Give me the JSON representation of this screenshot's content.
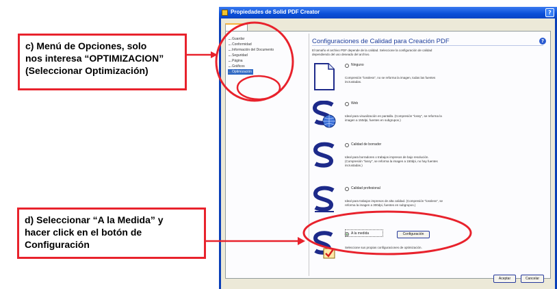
{
  "annotations": {
    "menu_note": {
      "lines": [
        "c) Menú de Opciones, solo",
        "nos interesa “OPTIMIZACION”",
        "(Seleccionar Optimización)"
      ]
    },
    "select_note": {
      "lines": [
        "d) Seleccionar “A la Medida” y",
        "hacer click en el botón de",
        "Configuración"
      ]
    },
    "highlight_color": "#e8222c"
  },
  "window": {
    "title": "Propiedades de Solid PDF Creator",
    "help_glyph": "?"
  },
  "tree": {
    "items": [
      {
        "label": "Guardar",
        "selected": false
      },
      {
        "label": "Conformidad",
        "selected": false
      },
      {
        "label": "Información del Documento",
        "selected": false
      },
      {
        "label": "Seguridad",
        "selected": false
      },
      {
        "label": "Página",
        "selected": false
      },
      {
        "label": "Gráficos",
        "selected": false
      },
      {
        "label": "Optimización",
        "selected": true
      }
    ]
  },
  "content": {
    "title": "Configuraciones de Calidad para Creación PDF",
    "description": [
      "El tamaño el archivo PDF depende de la calidad. Seleccione la configuración de calidad",
      "dependiendo del uso deseado del archivo."
    ],
    "options": [
      {
        "label": "Ninguno",
        "icon": "blank-page-icon",
        "selected": false,
        "desc": [
          "Compresión \"lossless\", no se reforma la imagen, todas las fuentes",
          "incrustadas."
        ]
      },
      {
        "label": "Web",
        "icon": "solid-web-globe-icon",
        "selected": false,
        "desc": [
          "Ideal para visualización en pantalla. (Compresión \"lossy\", se reforma la",
          "imagen a 150dpi, fuentes en subgrupos.)"
        ]
      },
      {
        "label": "Calidad de borrador",
        "icon": "solid-draft-icon",
        "selected": false,
        "desc": [
          "Ideal para borradores o trabajos impresos de bajo resolución.",
          "(Compresión \"lossy\", se reforma la imagen a 150dpi, no hay fuentes",
          "incrustadas.)"
        ]
      },
      {
        "label": "Calidad profesional",
        "icon": "solid-professional-icon",
        "selected": false,
        "desc": [
          "Ideal para trabajos impresos de alta calidad. (Compresión \"lossless\", se",
          "reforma la imagen a 300dpi, fuentes en subgrupos.)"
        ]
      },
      {
        "label": "A la medida",
        "icon": "solid-custom-check-icon",
        "selected": true,
        "desc": [
          "Seleccione sus propias configuraciones de optimización."
        ]
      }
    ],
    "config_button": "Configuración"
  },
  "buttons": {
    "ok": "Aceptar",
    "cancel": "Cancelar"
  }
}
